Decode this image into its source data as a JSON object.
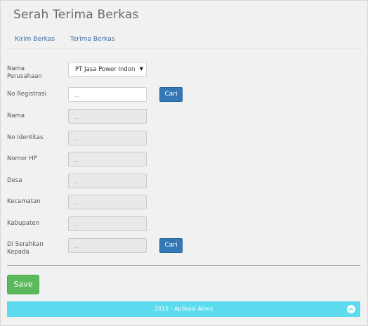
{
  "page": {
    "title": "Serah Terima Berkas"
  },
  "tabs": [
    {
      "label": "Kirim Berkas"
    },
    {
      "label": "Terima Berkas"
    }
  ],
  "form": {
    "nama_perusahaan": {
      "label_line1": "Nama",
      "label_line2": "Perusahaan",
      "value": "PT Jasa Power Indon"
    },
    "no_registrasi": {
      "label": "No Registrasi",
      "placeholder": "..."
    },
    "nama": {
      "label": "Nama",
      "placeholder": "..."
    },
    "no_identitas": {
      "label": "No Identitas",
      "placeholder": "..."
    },
    "nomor_hp": {
      "label": "Nomor HP",
      "placeholder": "..."
    },
    "desa": {
      "label": "Desa",
      "placeholder": "..."
    },
    "kecamatan": {
      "label": "Kecamatan",
      "placeholder": "..."
    },
    "kabupaten": {
      "label": "Kabupaten",
      "placeholder": "..."
    },
    "di_serahkan_kepada": {
      "label_line1": "Di Serahkan",
      "label_line2": "Kepada",
      "placeholder": "..."
    },
    "cari_label": "Cari"
  },
  "actions": {
    "save_label": "Save"
  },
  "footer": {
    "text": "2015 - Aplikasi Almis"
  },
  "colors": {
    "primary_button": "#3378b5",
    "save_button": "#5cb85c",
    "footer_bg": "#5ddcf0"
  }
}
